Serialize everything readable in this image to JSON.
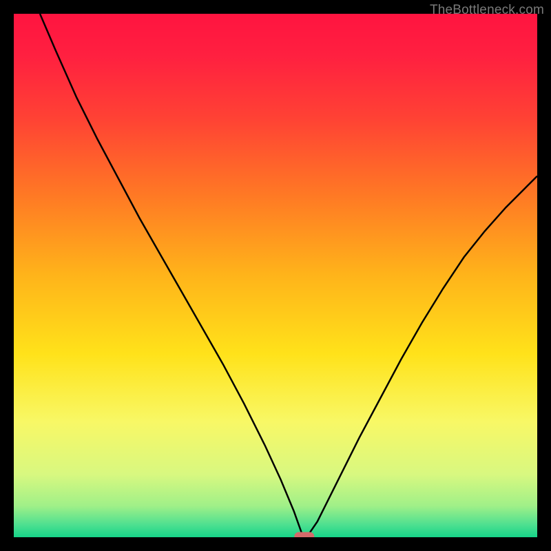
{
  "watermark": "TheBottleneck.com",
  "colors": {
    "gradient_stops": [
      {
        "offset": 0.0,
        "color": "#ff1440"
      },
      {
        "offset": 0.08,
        "color": "#ff2040"
      },
      {
        "offset": 0.2,
        "color": "#ff4234"
      },
      {
        "offset": 0.35,
        "color": "#ff7a24"
      },
      {
        "offset": 0.5,
        "color": "#ffb41a"
      },
      {
        "offset": 0.65,
        "color": "#ffe21a"
      },
      {
        "offset": 0.78,
        "color": "#f8f866"
      },
      {
        "offset": 0.88,
        "color": "#d8f880"
      },
      {
        "offset": 0.94,
        "color": "#a0f088"
      },
      {
        "offset": 0.975,
        "color": "#50e090"
      },
      {
        "offset": 1.0,
        "color": "#16d489"
      }
    ],
    "curve": "#000000",
    "marker_fill": "#d46a6a",
    "marker_stroke": "#d46a6a"
  },
  "chart_data": {
    "type": "line",
    "title": "",
    "xlabel": "",
    "ylabel": "",
    "xlim": [
      0,
      100
    ],
    "ylim": [
      0,
      100
    ],
    "legend": false,
    "grid": false,
    "marker": {
      "x": 55.5,
      "y": 0,
      "shape": "pill"
    },
    "series": [
      {
        "name": "curve",
        "x": [
          5,
          8,
          12,
          16,
          20,
          24,
          28,
          32,
          36,
          40,
          44,
          48,
          51,
          53.5,
          55,
          56.5,
          58,
          60,
          63,
          66,
          70,
          74,
          78,
          82,
          86,
          90,
          94,
          98,
          100
        ],
        "y": [
          100,
          93,
          84,
          76,
          68.5,
          61,
          54,
          47,
          40,
          33,
          25.5,
          17.5,
          11,
          5,
          0.8,
          0.8,
          3,
          7,
          13,
          19,
          26.5,
          34,
          41,
          47.5,
          53.5,
          58.5,
          63,
          67,
          69
        ]
      }
    ]
  }
}
